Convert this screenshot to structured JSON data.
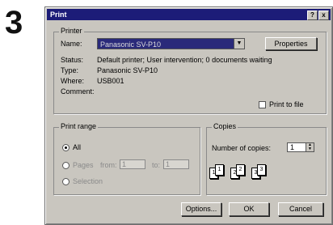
{
  "step_number": "3",
  "dialog": {
    "title": "Print",
    "help_button": "?",
    "close_button": "x"
  },
  "printer": {
    "group_label": "Printer",
    "name_label": "Name:",
    "name_value": "Panasonic SV-P10",
    "properties_label": "Properties",
    "status_label": "Status:",
    "status_value": "Default printer; User intervention; 0 documents waiting",
    "type_label": "Type:",
    "type_value": "Panasonic SV-P10",
    "where_label": "Where:",
    "where_value": "USB001",
    "comment_label": "Comment:",
    "print_to_file_label": "Print to file"
  },
  "print_range": {
    "group_label": "Print range",
    "all_label": "All",
    "pages_label": "Pages",
    "from_label": "from:",
    "from_value": "1",
    "to_label": "to:",
    "to_value": "1",
    "selection_label": "Selection"
  },
  "copies": {
    "group_label": "Copies",
    "number_label": "Number of copies:",
    "number_value": "1",
    "collate_pages": [
      "1",
      "1",
      "2",
      "2",
      "3",
      "3"
    ]
  },
  "buttons": {
    "options": "Options...",
    "ok": "OK",
    "cancel": "Cancel"
  }
}
